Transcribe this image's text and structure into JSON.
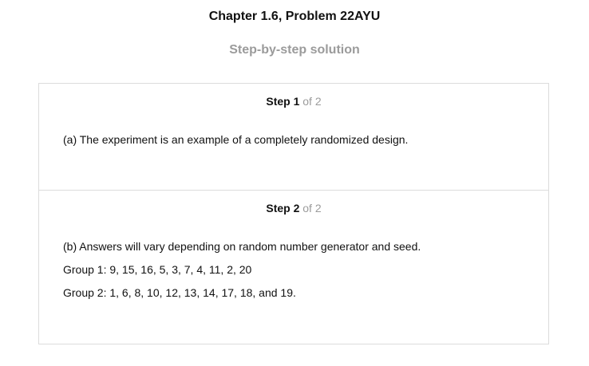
{
  "header": {
    "title": "Chapter 1.6, Problem 22AYU",
    "subtitle": "Step-by-step solution"
  },
  "steps": [
    {
      "label": "Step 1",
      "of": "of 2",
      "lines": [
        "(a) The experiment is an example of a completely randomized design."
      ]
    },
    {
      "label": "Step 2",
      "of": "of 2",
      "lines": [
        "(b) Answers will vary depending on random number generator and seed.",
        "Group 1: 9, 15, 16, 5, 3, 7, 4, 11, 2, 20",
        "Group 2: 1, 6, 8, 10, 12, 13, 14, 17, 18, and 19."
      ]
    }
  ]
}
